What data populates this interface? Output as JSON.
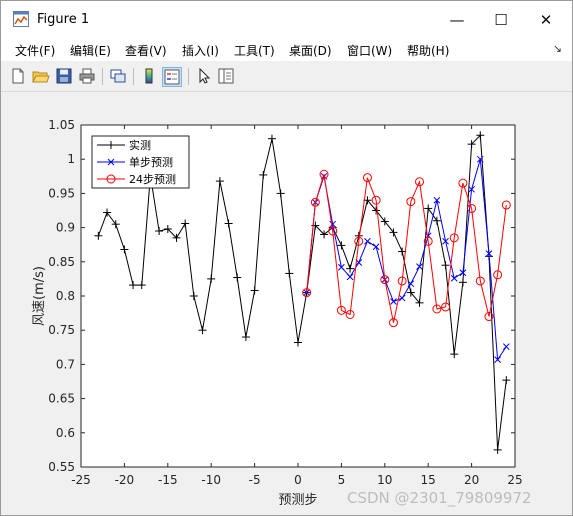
{
  "window": {
    "title": "Figure 1"
  },
  "window_controls": {
    "minimize": "—",
    "maximize": "☐",
    "close": "✕"
  },
  "menu": {
    "items": [
      {
        "label": "文件(F)"
      },
      {
        "label": "编辑(E)"
      },
      {
        "label": "查看(V)"
      },
      {
        "label": "插入(I)"
      },
      {
        "label": "工具(T)"
      },
      {
        "label": "桌面(D)"
      },
      {
        "label": "窗口(W)"
      },
      {
        "label": "帮助(H)"
      }
    ],
    "dock_arrow": "↘"
  },
  "toolbar": {
    "icons": [
      "new-figure-icon",
      "open-file-icon",
      "save-icon",
      "print-icon",
      "link-plot-icon",
      "colorbar-icon",
      "legend-icon",
      "pointer-icon",
      "property-inspector-icon"
    ],
    "active": "legend-icon"
  },
  "watermark": "CSDN @2301_79809972",
  "chart_data": {
    "type": "line",
    "title": "",
    "xlabel": "预测步",
    "ylabel": "风速(m/s)",
    "xlim": [
      -25,
      25
    ],
    "ylim": [
      0.55,
      1.05
    ],
    "xticks": [
      -25,
      -20,
      -15,
      -10,
      -5,
      0,
      5,
      10,
      15,
      20,
      25
    ],
    "yticks": [
      0.55,
      0.6,
      0.65,
      0.7,
      0.75,
      0.8,
      0.85,
      0.9,
      0.95,
      1,
      1.05
    ],
    "xtick_labels": [
      "-25",
      "-20",
      "-15",
      "-10",
      "-5",
      "0",
      "5",
      "10",
      "15",
      "20",
      "25"
    ],
    "ytick_labels": [
      "0.55",
      "0.6",
      "0.65",
      "0.7",
      "0.75",
      "0.8",
      "0.85",
      "0.9",
      "0.95",
      "1",
      "1.05"
    ],
    "legend_position": "top-left",
    "grid": false,
    "series": [
      {
        "name": "实测",
        "color": "#000000",
        "marker": "plus",
        "x": [
          -23,
          -22,
          -21,
          -20,
          -19,
          -18,
          -17,
          -16,
          -15,
          -14,
          -13,
          -12,
          -11,
          -10,
          -9,
          -8,
          -7,
          -6,
          -5,
          -4,
          -3,
          -2,
          -1,
          0,
          1,
          2,
          3,
          4,
          5,
          6,
          7,
          8,
          9,
          10,
          11,
          12,
          13,
          14,
          15,
          16,
          17,
          18,
          19,
          20,
          21,
          22,
          23,
          24
        ],
        "y": [
          0.888,
          0.922,
          0.905,
          0.868,
          0.816,
          0.816,
          0.976,
          0.895,
          0.898,
          0.885,
          0.906,
          0.8,
          0.75,
          0.825,
          0.968,
          0.906,
          0.827,
          0.74,
          0.808,
          0.977,
          1.03,
          0.95,
          0.833,
          0.732,
          0.805,
          0.903,
          0.89,
          0.9,
          0.874,
          0.84,
          0.888,
          0.94,
          0.925,
          0.909,
          0.893,
          0.865,
          0.805,
          0.79,
          0.928,
          0.91,
          0.845,
          0.715,
          0.82,
          1.022,
          1.035,
          0.858,
          0.575,
          0.677
        ]
      },
      {
        "name": "单步预测",
        "color": "#0000ff",
        "marker": "x",
        "x": [
          1,
          2,
          3,
          4,
          5,
          6,
          7,
          8,
          9,
          10,
          11,
          12,
          13,
          14,
          15,
          16,
          17,
          18,
          19,
          20,
          21,
          22,
          23,
          24
        ],
        "y": [
          0.805,
          0.937,
          0.975,
          0.905,
          0.842,
          0.828,
          0.849,
          0.88,
          0.872,
          0.824,
          0.792,
          0.797,
          0.818,
          0.843,
          0.888,
          0.94,
          0.88,
          0.826,
          0.834,
          0.956,
          1.0,
          0.862,
          0.707,
          0.726
        ]
      },
      {
        "name": "24步预测",
        "color": "#ff0000",
        "marker": "circle",
        "x": [
          1,
          2,
          3,
          4,
          5,
          6,
          7,
          8,
          9,
          10,
          11,
          12,
          13,
          14,
          15,
          16,
          17,
          18,
          19,
          20,
          21,
          22,
          23,
          24
        ],
        "y": [
          0.805,
          0.937,
          0.978,
          0.895,
          0.779,
          0.773,
          0.88,
          0.973,
          0.94,
          0.824,
          0.761,
          0.822,
          0.938,
          0.967,
          0.88,
          0.781,
          0.784,
          0.885,
          0.965,
          0.928,
          0.822,
          0.77,
          0.831,
          0.933
        ]
      }
    ]
  }
}
